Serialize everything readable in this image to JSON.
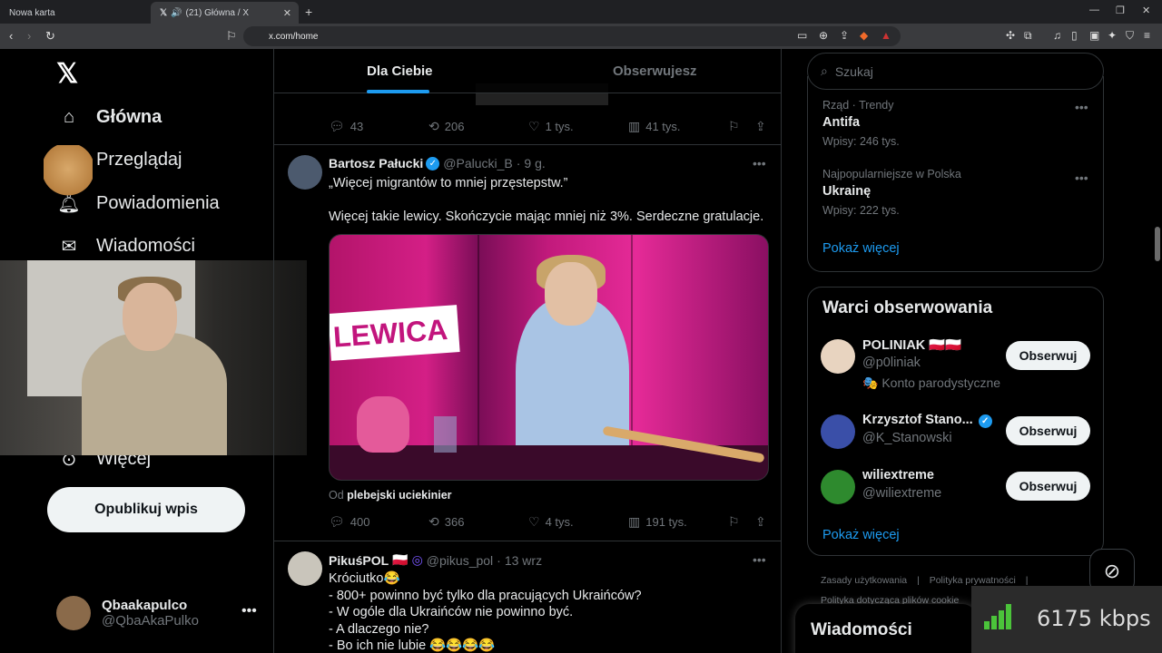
{
  "browser": {
    "tabs": [
      {
        "title": "Nowa karta"
      },
      {
        "title": "(21) Główna / X"
      }
    ],
    "url": "x.com/home"
  },
  "nav": {
    "items": [
      {
        "label": "Główna",
        "icon": "home-icon"
      },
      {
        "label": "Przeglądaj",
        "icon": "search-icon"
      },
      {
        "label": "Powiadomienia",
        "icon": "bell-icon"
      },
      {
        "label": "Wiadomości",
        "icon": "mail-icon"
      },
      {
        "label": "Więcej",
        "icon": "more-circle-icon"
      }
    ],
    "post_button": "Opublikuj wpis",
    "user": {
      "name": "Qbaakapulco",
      "handle": "@QbaAkaPulko"
    }
  },
  "feed": {
    "tabs": [
      {
        "label": "Dla Ciebie",
        "active": true
      },
      {
        "label": "Obserwujesz",
        "active": false
      }
    ],
    "prev_actions": {
      "replies": "43",
      "reposts": "206",
      "likes": "1 tys.",
      "views": "41 tys."
    },
    "tweets": [
      {
        "name": "Bartosz Pałucki",
        "handle": "@Palucki_B",
        "time": "9 g.",
        "text1": "„Więcej migrantów to mniej przęstepstw.”",
        "text2": "Więcej takie lewicy. Skończycie mając mniej niż 3%. Serdeczne gratulacje.",
        "media_text": "LEWICA",
        "source_prefix": "Od",
        "source_name": "plebejski uciekinier",
        "actions": {
          "replies": "400",
          "reposts": "366",
          "likes": "4 tys.",
          "views": "191 tys."
        }
      },
      {
        "name": "PikuśPOL",
        "flag": "🇵🇱",
        "handle": "@pikus_pol",
        "time": "13 wrz",
        "lines": [
          "Króciutko😂",
          "- 800+ powinno być tylko dla pracujących Ukraińców?",
          "- W ogóle dla Ukraińców nie powinno być.",
          "- A dlaczego nie?",
          "- Bo ich nie lubie 😂😂😂😂"
        ]
      }
    ]
  },
  "sidebar": {
    "search_placeholder": "Szukaj",
    "trends": [
      {
        "category": "Rząd · Trendy",
        "title": "Antifa",
        "count": "Wpisy: 246 tys."
      },
      {
        "category": "Najpopularniejsze w Polska",
        "title": "Ukrainę",
        "count": "Wpisy: 222 tys."
      }
    ],
    "show_more": "Pokaż więcej",
    "who_to_follow": {
      "title": "Warci obserwowania",
      "accounts": [
        {
          "name": "POLINIAK 🇵🇱🇵🇱",
          "handle": "@p0liniak",
          "extra": "🎭 Konto parodystyczne"
        },
        {
          "name": "Krzysztof Stano...",
          "handle": "@K_Stanowski",
          "verified": true
        },
        {
          "name": "wiliextreme",
          "handle": "@wiliextreme"
        }
      ],
      "follow_label": "Obserwuj",
      "show_more": "Pokaż więcej"
    },
    "footer": [
      "Zasady użytkowania",
      "Polityka prywatności",
      "Polityka dotycząca plików cookie"
    ],
    "dm_title": "Wiadomości"
  },
  "overlay": {
    "bitrate": "6175 kbps"
  },
  "colors": {
    "accent": "#1d9bf0",
    "bitrate_bars": "#4bc33a"
  }
}
